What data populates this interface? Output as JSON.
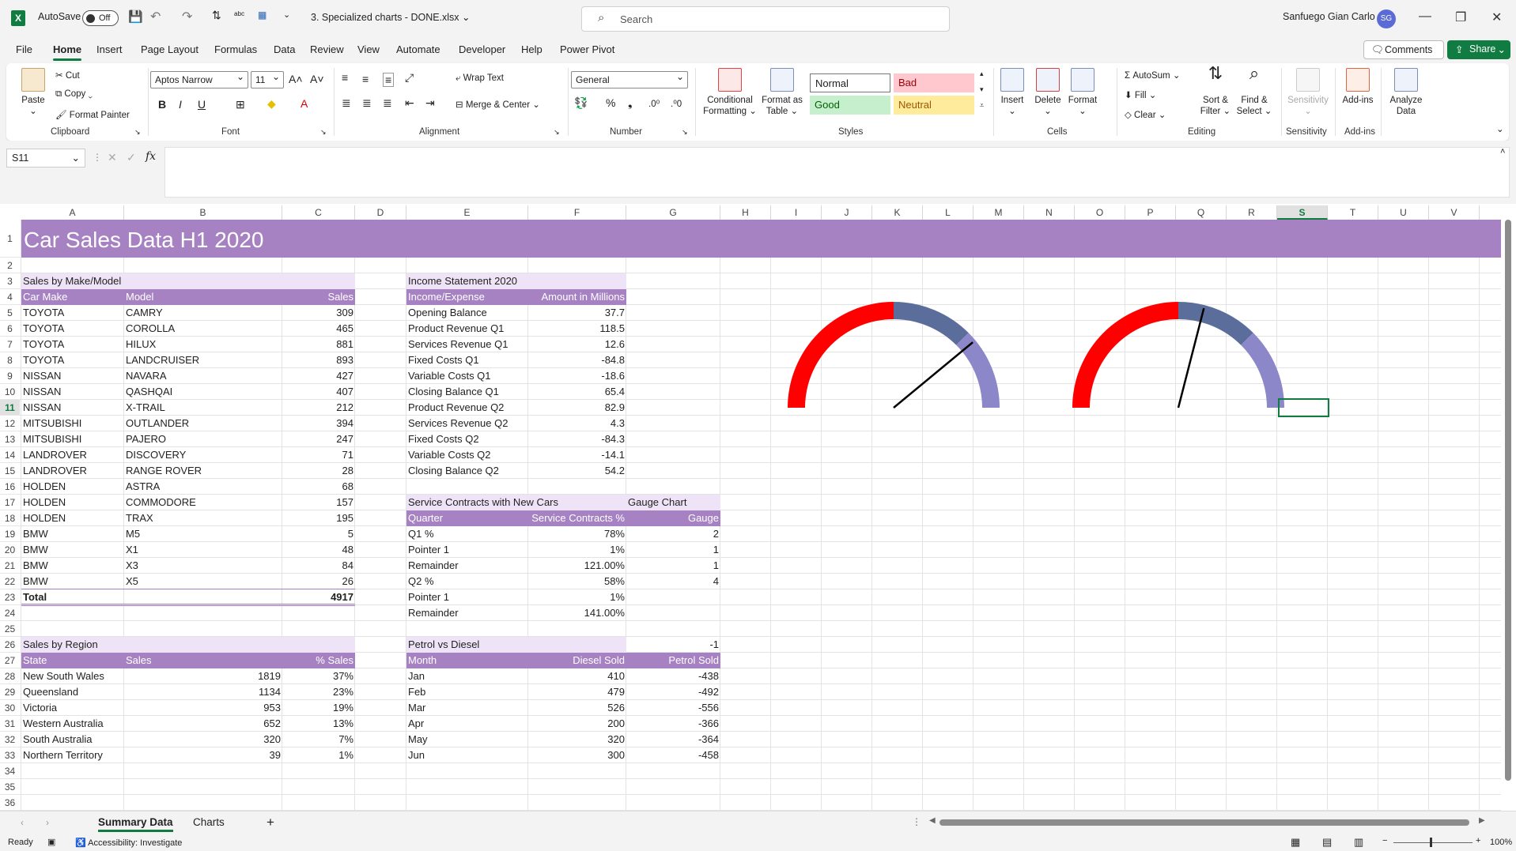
{
  "titlebar": {
    "autosave_label": "AutoSave",
    "autosave_state": "Off",
    "filename": "3. Specialized charts - DONE.xlsx",
    "search_placeholder": "Search",
    "user_name": "Sanfuego Gian Carlo",
    "user_initials": "SG"
  },
  "menu": [
    "File",
    "Home",
    "Insert",
    "Page Layout",
    "Formulas",
    "Data",
    "Review",
    "View",
    "Automate",
    "Developer",
    "Help",
    "Power Pivot"
  ],
  "menu_active": "Home",
  "actions": {
    "comments": "Comments",
    "share": "Share"
  },
  "ribbon": {
    "clipboard": {
      "paste": "Paste",
      "cut": "Cut",
      "copy": "Copy",
      "format_painter": "Format Painter",
      "label": "Clipboard"
    },
    "font": {
      "name": "Aptos Narrow",
      "size": "11",
      "label": "Font"
    },
    "alignment": {
      "wrap": "Wrap Text",
      "merge": "Merge & Center",
      "label": "Alignment"
    },
    "number": {
      "format": "General",
      "label": "Number"
    },
    "styles": {
      "conditional": "Conditional Formatting",
      "format_table": "Format as Table",
      "normal": "Normal",
      "bad": "Bad",
      "good": "Good",
      "neutral": "Neutral",
      "label": "Styles"
    },
    "cells": {
      "insert": "Insert",
      "delete": "Delete",
      "format": "Format",
      "label": "Cells"
    },
    "editing": {
      "autosum": "AutoSum",
      "fill": "Fill",
      "clear": "Clear",
      "sort": "Sort & Filter",
      "find": "Find & Select",
      "label": "Editing"
    },
    "sensitivity": {
      "btn": "Sensitivity",
      "label": "Sensitivity"
    },
    "addins": {
      "btn": "Add-ins",
      "label": "Add-ins"
    },
    "analyze": {
      "btn": "Analyze Data"
    }
  },
  "namebox": "S11",
  "columns": [
    "A",
    "B",
    "C",
    "D",
    "E",
    "F",
    "G",
    "H",
    "I",
    "J",
    "K",
    "L",
    "M",
    "N",
    "O",
    "P",
    "Q",
    "R",
    "S",
    "T",
    "U",
    "V"
  ],
  "selected_column": "S",
  "selected_row": 11,
  "banner": "Car Sales Data H1 2020",
  "sales_by_make": {
    "title": "Sales by Make/Model",
    "headers": [
      "Car Make",
      "Model",
      "Sales"
    ],
    "rows": [
      [
        "TOYOTA",
        "CAMRY",
        "309"
      ],
      [
        "TOYOTA",
        "COROLLA",
        "465"
      ],
      [
        "TOYOTA",
        "HILUX",
        "881"
      ],
      [
        "TOYOTA",
        "LANDCRUISER",
        "893"
      ],
      [
        "NISSAN",
        "NAVARA",
        "427"
      ],
      [
        "NISSAN",
        "QASHQAI",
        "407"
      ],
      [
        "NISSAN",
        "X-TRAIL",
        "212"
      ],
      [
        "MITSUBISHI",
        "OUTLANDER",
        "394"
      ],
      [
        "MITSUBISHI",
        "PAJERO",
        "247"
      ],
      [
        "LANDROVER",
        "DISCOVERY",
        "71"
      ],
      [
        "LANDROVER",
        "RANGE ROVER",
        "28"
      ],
      [
        "HOLDEN",
        "ASTRA",
        "68"
      ],
      [
        "HOLDEN",
        "COMMODORE",
        "157"
      ],
      [
        "HOLDEN",
        "TRAX",
        "195"
      ],
      [
        "BMW",
        "M5",
        "5"
      ],
      [
        "BMW",
        "X1",
        "48"
      ],
      [
        "BMW",
        "X3",
        "84"
      ],
      [
        "BMW",
        "X5",
        "26"
      ]
    ],
    "total_label": "Total",
    "total_value": "4917"
  },
  "income": {
    "title": "Income Statement 2020",
    "headers": [
      "Income/Expense",
      "Amount in Millions"
    ],
    "rows": [
      [
        "Opening Balance",
        "37.7"
      ],
      [
        "Product Revenue Q1",
        "118.5"
      ],
      [
        "Services Revenue Q1",
        "12.6"
      ],
      [
        "Fixed Costs Q1",
        "-84.8"
      ],
      [
        "Variable Costs Q1",
        "-18.6"
      ],
      [
        "Closing Balance Q1",
        "65.4"
      ],
      [
        "Product Revenue Q2",
        "82.9"
      ],
      [
        "Services Revenue Q2",
        "4.3"
      ],
      [
        "Fixed Costs Q2",
        "-84.3"
      ],
      [
        "Variable Costs Q2",
        "-14.1"
      ],
      [
        "Closing Balance Q2",
        "54.2"
      ]
    ]
  },
  "service": {
    "title": "Service Contracts with New Cars",
    "gauge_title": "Gauge Chart",
    "headers": [
      "Quarter",
      "Service Contracts %",
      "Gauge"
    ],
    "rows": [
      [
        "Q1 %",
        "78%",
        "2"
      ],
      [
        "Pointer 1",
        "1%",
        "1"
      ],
      [
        "Remainder",
        "121.00%",
        "1"
      ],
      [
        "Q2 %",
        "58%",
        "4"
      ],
      [
        "Pointer 1",
        "1%",
        ""
      ],
      [
        "Remainder",
        "141.00%",
        ""
      ]
    ]
  },
  "petrol": {
    "title": "Petrol vs Diesel",
    "g_value": "-1",
    "headers": [
      "Month",
      "Diesel Sold",
      "Petrol Sold"
    ],
    "rows": [
      [
        "Jan",
        "410",
        "-438"
      ],
      [
        "Feb",
        "479",
        "-492"
      ],
      [
        "Mar",
        "526",
        "-556"
      ],
      [
        "Apr",
        "200",
        "-366"
      ],
      [
        "May",
        "320",
        "-364"
      ],
      [
        "Jun",
        "300",
        "-458"
      ]
    ]
  },
  "region": {
    "title": "Sales by Region",
    "headers": [
      "State",
      "Sales",
      "% Sales"
    ],
    "rows": [
      [
        "New South Wales",
        "1819",
        "37%"
      ],
      [
        "Queensland",
        "1134",
        "23%"
      ],
      [
        "Victoria",
        "953",
        "19%"
      ],
      [
        "Western Australia",
        "652",
        "13%"
      ],
      [
        "South Australia",
        "320",
        "7%"
      ],
      [
        "Northern Territory",
        "39",
        "1%"
      ]
    ]
  },
  "chart_data": [
    {
      "type": "gauge",
      "bands": [
        {
          "value": 2,
          "color": "#ff0000"
        },
        {
          "value": 1,
          "color": "#5b6e9b"
        },
        {
          "value": 1,
          "color": "#8b87c9"
        }
      ],
      "pointer": 0.78
    },
    {
      "type": "gauge",
      "bands": [
        {
          "value": 2,
          "color": "#ff0000"
        },
        {
          "value": 1,
          "color": "#5b6e9b"
        },
        {
          "value": 1,
          "color": "#8b87c9"
        }
      ],
      "pointer": 0.58
    }
  ],
  "sheets": [
    "Summary Data",
    "Charts"
  ],
  "active_sheet": "Summary Data",
  "status": {
    "ready": "Ready",
    "accessibility": "Accessibility: Investigate",
    "zoom": "100%"
  }
}
